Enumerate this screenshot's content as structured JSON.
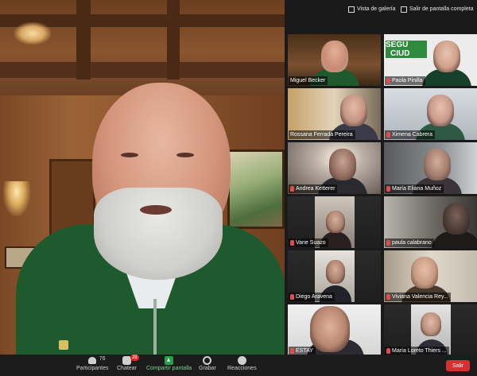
{
  "header": {
    "gallery_view_label": "Vista de galería",
    "exit_fullscreen_label": "Salir de pantalla completa"
  },
  "participants": [
    {
      "name": "Miguel Becker"
    },
    {
      "name": "Paola Pinilla"
    },
    {
      "name": "Rossana Ferrada Pereira"
    },
    {
      "name": "Ximena Cabrera"
    },
    {
      "name": "Andrea Ketterer"
    },
    {
      "name": "María Eliana Muñoz"
    },
    {
      "name": "Vane Suazo"
    },
    {
      "name": "paula calabrano"
    },
    {
      "name": "Diego Aravena"
    },
    {
      "name": "Viviana Valencia Rey..."
    },
    {
      "name": "ESTAY"
    },
    {
      "name": "María Loreto Thiers ..."
    }
  ],
  "background_sign": {
    "line1": "SEGU",
    "line2": "CIUD"
  },
  "toolbar": {
    "participants_label": "Participantes",
    "participants_count": "76",
    "chat_label": "Chatear",
    "chat_badge": "28",
    "share_label": "Compartir pantalla",
    "record_label": "Grabar",
    "reactions_label": "Reacciones",
    "end_label": "Salir"
  },
  "colors": {
    "active_speaker_outline": "#d7d64a",
    "share_green": "#27a04a",
    "end_red": "#d62f2f"
  }
}
